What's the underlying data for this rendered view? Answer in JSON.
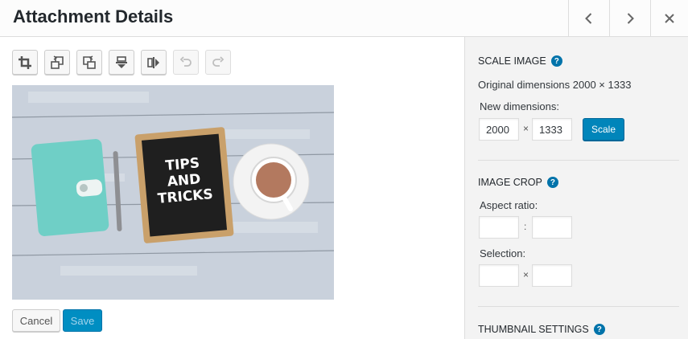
{
  "header": {
    "title": "Attachment Details"
  },
  "toolbar": {
    "buttons": [
      {
        "name": "crop-icon"
      },
      {
        "name": "rotate-left-icon"
      },
      {
        "name": "rotate-right-icon"
      },
      {
        "name": "flip-vertical-icon"
      },
      {
        "name": "flip-horizontal-icon"
      },
      {
        "name": "undo-icon"
      },
      {
        "name": "redo-icon"
      }
    ]
  },
  "preview": {
    "board_text_line1": "TIPS",
    "board_text_line2": "AND",
    "board_text_line3": "TRICKS"
  },
  "actions": {
    "cancel_label": "Cancel",
    "save_label": "Save"
  },
  "scale": {
    "title": "Scale Image",
    "original_dimensions": "Original dimensions 2000 × 1333",
    "new_dimensions_label": "New dimensions:",
    "width": "2000",
    "height": "1333",
    "separator": "×",
    "button_label": "Scale"
  },
  "crop": {
    "title": "Image Crop",
    "aspect_ratio_label": "Aspect ratio:",
    "aspect_separator": ":",
    "selection_label": "Selection:",
    "selection_separator": "×"
  },
  "thumbnail": {
    "title": "Thumbnail Settings"
  },
  "help_glyph": "?",
  "colors": {
    "primary": "#0085ba",
    "save_disabled": "#008ec2"
  }
}
